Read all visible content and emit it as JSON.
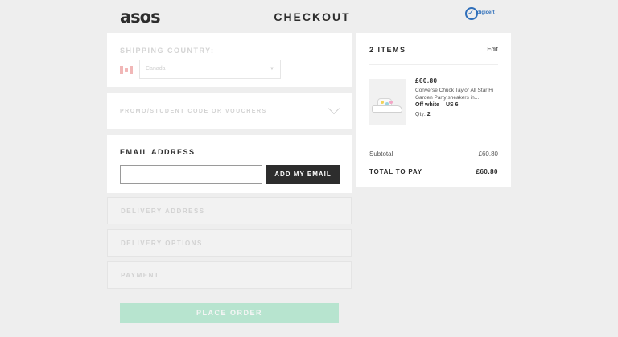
{
  "header": {
    "logo": "asos",
    "title": "CHECKOUT",
    "badge": "digicert"
  },
  "shipping": {
    "label": "SHIPPING COUNTRY:",
    "country": "Canada"
  },
  "promo": {
    "label": "PROMO/STUDENT CODE OR VOUCHERS"
  },
  "email": {
    "label": "EMAIL ADDRESS",
    "value": "",
    "placeholder": "",
    "button": "ADD MY EMAIL"
  },
  "sections": [
    {
      "label": "DELIVERY ADDRESS"
    },
    {
      "label": "DELIVERY OPTIONS"
    },
    {
      "label": "PAYMENT"
    }
  ],
  "place_order": "PLACE ORDER",
  "summary": {
    "title": "2 ITEMS",
    "edit": "Edit",
    "item": {
      "price": "£60.80",
      "name": "Converse Chuck Taylor All Star Hi Garden Party sneakers in...",
      "color": "Off white",
      "size": "US 6",
      "qty_label": "Qty:",
      "qty": "2"
    },
    "subtotal_label": "Subtotal",
    "subtotal": "£60.80",
    "total_label": "TOTAL TO PAY",
    "total": "£60.80"
  },
  "colors": {
    "accent_disabled": "#b7e4cf",
    "dark": "#2d2d2d",
    "badge_blue": "#2f6fba"
  }
}
